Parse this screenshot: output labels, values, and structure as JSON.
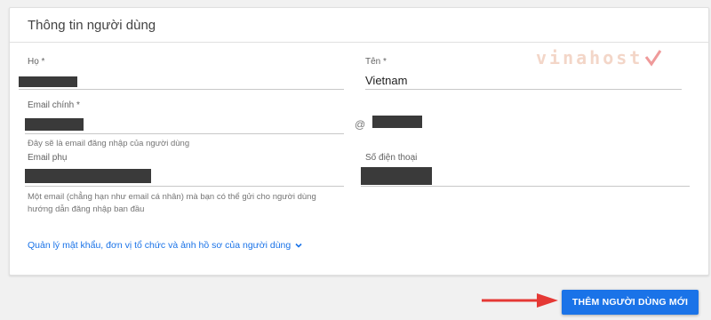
{
  "form": {
    "title": "Thông tin người dùng",
    "last_name": {
      "label": "Họ *"
    },
    "first_name": {
      "label": "Tên *",
      "value": "Vietnam"
    },
    "primary_email": {
      "label": "Email chính *",
      "at": "@",
      "helper": "Đây sẽ là email đăng nhập của người dùng"
    },
    "secondary_email": {
      "label": "Email phụ",
      "helper_line1": "Một email (chẳng hạn như email cá nhân) mà bạn có thể gửi cho người dùng",
      "helper_line2": "hướng dẫn đăng nhập ban đầu"
    },
    "phone": {
      "label": "Số điện thoại"
    },
    "more_link": "Quản lý mật khẩu, đơn vị tổ chức và ảnh hồ sơ của người dùng",
    "more_link_icon": "chevron-down-icon"
  },
  "watermark": {
    "text": "vinahost",
    "accent_color": "#e53935"
  },
  "footer": {
    "submit_label": "THÊM NGƯỜI DÙNG MỚI"
  },
  "colors": {
    "accent": "#1a73e8",
    "arrow": "#e53935"
  }
}
